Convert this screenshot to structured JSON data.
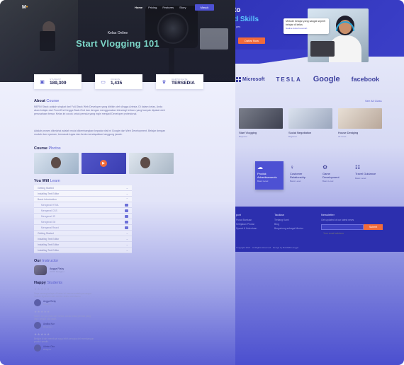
{
  "back": {
    "hero_heading_line1": "to",
    "hero_heading_accent": "d Skills",
    "hero_sub": "yes",
    "hero_button": "Daftar Now",
    "quote_text": "Metode belajar yang sangat seperti belajar di kelas",
    "quote_author": "Nadine Aulia Kusumah",
    "brands": [
      "Microsoft",
      "TESLA",
      "Google",
      "facebook"
    ],
    "see_all": "See All Class",
    "courses": [
      {
        "title": "Start Vlogging",
        "sub": "Beginner"
      },
      {
        "title": "Social Negotiation",
        "sub": "Beginner"
      },
      {
        "title": "House Desiging",
        "sub": "All Level"
      }
    ],
    "features": [
      {
        "icon": "☁",
        "title": "Produk Advertisements",
        "sub": "Basic Level"
      },
      {
        "icon": "♀",
        "title": "Customer Relationship",
        "sub": "Basic Level"
      },
      {
        "icon": "⚙",
        "title": "Game Development",
        "sub": "Basic Level"
      },
      {
        "icon": "☷",
        "title": "Travel Guidance",
        "sub": "Basic Level"
      }
    ],
    "footer": {
      "col1_title": "port",
      "col1_links": [
        "Pusat Bantuan",
        "Kebijakan Privasi",
        "Syarat & Ketentuan"
      ],
      "col2_title": "Tautkan",
      "col2_links": [
        "Tentang Kami",
        "Blog",
        "Bergabung sebagai Mentor"
      ],
      "col3_title": "Newsletter",
      "col3_text": "Get updated of our latest news",
      "subscribe_placeholder": "Your email address",
      "subscribe_button": "Submit",
      "copyright": "Copyright 2021 · All Rights Reserved · Design by BuildWith Angga"
    }
  },
  "front": {
    "logo": "M",
    "logo_dot": "•",
    "nav": [
      "Home",
      "Pricing",
      "Features",
      "Story"
    ],
    "nav_button": "Masuk",
    "kicker": "Kelas Online",
    "title": "Start Vlogging 101",
    "stats": [
      {
        "icon": "▣",
        "label": "STUDENT",
        "value": "189,309"
      },
      {
        "icon": "▭",
        "label": "VIDEOS",
        "value": "1,435"
      },
      {
        "icon": "♛",
        "label": "CERTIFICATE",
        "value": "TERSEDIA"
      }
    ],
    "about_title": "About",
    "about_accent": "Course",
    "about_p1": "MERN Stack adalah singkat dari Full-Stack Web Developer yang dibikin oleh Angga Ariesta. Di dalam kelas, Anda akan belajar dari Front-End hingga Back-End dan dengan menggunakan teknologi terbaru yang banyak dipakai oleh perusahaan besar. Kelas ini cocok untuk pemula yang ingin menjadi Developer profesional.",
    "about_p2": "Adalah proses diketahui adalah mulai dikembangkan kepada nilai ini Google dan Web Development, Belajar dengan mudah dan nyaman, termasuk tugas dan Anda mendapatkan tanggung jawab.",
    "photos_title": "Course",
    "photos_accent": "Photos",
    "learn_title": "You Will",
    "learn_accent": "Learn",
    "learn_rows": [
      "Getting Started",
      "Installing Text Editor",
      "Basic Introduction"
    ],
    "learn_sub": [
      "Mengenal HTML",
      "Mengenal CSS",
      "Mengenal JS",
      "Mengenal Git",
      "Mengenal React"
    ],
    "learn_rows2": [
      "Getting Started",
      "Installing Text Editor",
      "Installing Text Editor",
      "Installing Text Editor"
    ],
    "instructor_title": "Our",
    "instructor_accent": "Instructor",
    "instructor_name": "Angga Risky",
    "instructor_role": "UI/UX Designer",
    "reviews_title": "Happy",
    "reviews_accent": "Students",
    "reviews": [
      {
        "text": "Saya senang belajar di kelas ini karena materinya sangat mudah dipahami dan mentor selalu membantu.",
        "name": "Angga Rizky",
        "role": "Designer"
      },
      {
        "text": "Materi sangat jelas dan runtut, cocok untuk pemula yang ingin belajar dari awal.",
        "name": "Andika Nur",
        "role": "Developer"
      },
      {
        "text": "Belajar di sini membuat saya lebih percaya diri membangun produk sendiri.",
        "name": "Adrian Oka",
        "role": "Designer"
      }
    ]
  },
  "colors": {
    "primary": "#5b5fcf",
    "accent_orange": "#f26b3a",
    "hero_teal": "#7cd6c8",
    "dark_text": "#1d1f4f"
  }
}
